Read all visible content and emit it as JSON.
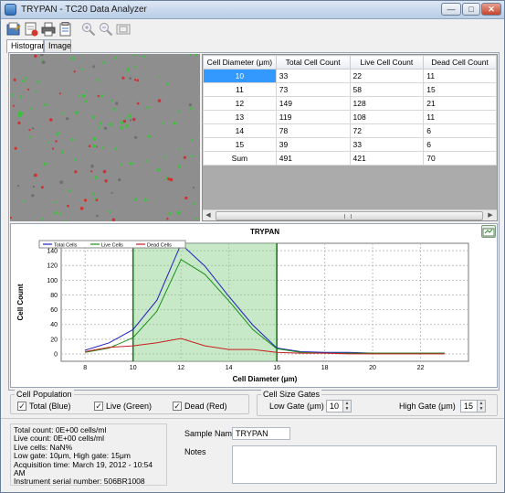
{
  "window": {
    "title": "TRYPAN - TC20 Data Analyzer"
  },
  "titlebar_buttons": {
    "minimize": "—",
    "maximize": "□",
    "close": "✕"
  },
  "toolbar": {
    "icons": [
      "open-icon",
      "save-icon",
      "print-icon",
      "report-icon",
      "zoom-in-icon",
      "zoom-out-icon",
      "fit-icon"
    ]
  },
  "tabs": [
    {
      "label": "Histogram",
      "active": true
    },
    {
      "label": "Image",
      "active": false
    }
  ],
  "table": {
    "headers": [
      "Cell Diameter (μm)",
      "Total Cell Count",
      "Live Cell Count",
      "Dead Cell Count"
    ],
    "rows": [
      [
        "10",
        "33",
        "22",
        "11"
      ],
      [
        "11",
        "73",
        "58",
        "15"
      ],
      [
        "12",
        "149",
        "128",
        "21"
      ],
      [
        "13",
        "119",
        "108",
        "11"
      ],
      [
        "14",
        "78",
        "72",
        "6"
      ],
      [
        "15",
        "39",
        "33",
        "6"
      ],
      [
        "Sum",
        "491",
        "421",
        "70"
      ]
    ],
    "selected_row": 0
  },
  "chart_data": {
    "type": "line",
    "title": "TRYPAN",
    "xlabel": "Cell Diameter (μm)",
    "ylabel": "Cell Count",
    "xlim": [
      7,
      24
    ],
    "ylim": [
      -10,
      150
    ],
    "xticks": [
      8,
      10,
      12,
      14,
      16,
      18,
      20,
      22
    ],
    "yticks": [
      0,
      20,
      40,
      60,
      80,
      100,
      120,
      140
    ],
    "legend_position": "top-left",
    "gate": {
      "low": 10,
      "high": 16
    },
    "series": [
      {
        "name": "Total Cells",
        "color": "#1f1fbf",
        "x": [
          8,
          9,
          10,
          11,
          12,
          13,
          14,
          15,
          16,
          17,
          18,
          19,
          20,
          21,
          22,
          23
        ],
        "y": [
          5,
          15,
          33,
          73,
          149,
          119,
          78,
          39,
          8,
          3,
          2,
          2,
          1,
          1,
          1,
          1
        ]
      },
      {
        "name": "Live Cells",
        "color": "#1a8f1a",
        "x": [
          8,
          9,
          10,
          11,
          12,
          13,
          14,
          15,
          16,
          17,
          18,
          19,
          20,
          21,
          22,
          23
        ],
        "y": [
          2,
          8,
          22,
          58,
          128,
          108,
          72,
          33,
          7,
          2,
          1,
          1,
          1,
          1,
          1,
          1
        ]
      },
      {
        "name": "Dead Cells",
        "color": "#c81e1e",
        "x": [
          8,
          9,
          10,
          11,
          12,
          13,
          14,
          15,
          16,
          17,
          18,
          19,
          20,
          21,
          22,
          23
        ],
        "y": [
          3,
          9,
          11,
          15,
          21,
          11,
          6,
          6,
          2,
          1,
          1,
          0,
          0,
          0,
          0,
          0
        ]
      }
    ]
  },
  "colors": {
    "gate_fill": "#8fd48f",
    "gate_line": "#1c7a1c",
    "selection": "#3399ff"
  },
  "cell_population": {
    "title": "Cell Population",
    "items": [
      {
        "label": "Total (Blue)",
        "checked": true
      },
      {
        "label": "Live (Green)",
        "checked": true
      },
      {
        "label": "Dead (Red)",
        "checked": true
      }
    ]
  },
  "cell_size_gates": {
    "title": "Cell Size Gates",
    "low_label": "Low Gate (μm)",
    "low_value": "10",
    "high_label": "High Gate (μm)",
    "high_value": "15"
  },
  "info": {
    "lines": [
      "Total count: 0E+00 cells/ml",
      "Live count: 0E+00 cells/ml",
      "Live cells: NaN%",
      "Low gate: 10μm, High gate: 15μm",
      "Acquisition time: March 19, 2012 - 10:54 AM",
      "Instrument serial number: 506BR1008"
    ]
  },
  "sample": {
    "name_label": "Sample Name",
    "name_value": "TRYPAN",
    "notes_label": "Notes",
    "notes_value": ""
  }
}
